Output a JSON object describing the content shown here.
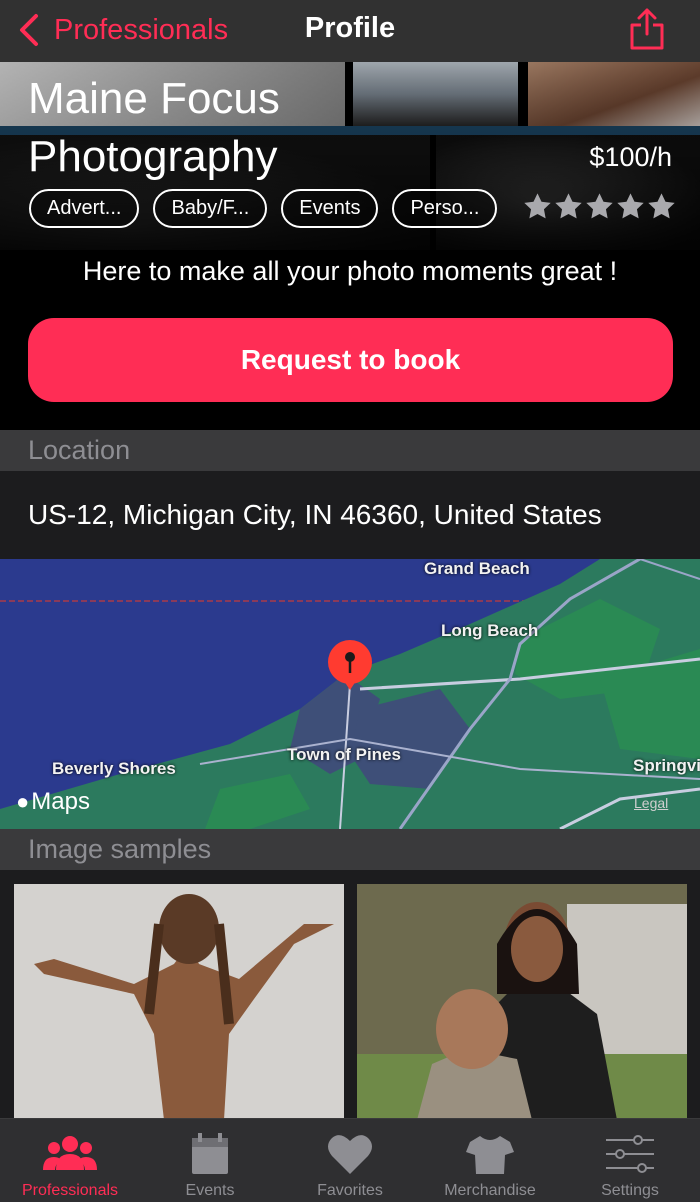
{
  "nav": {
    "back_label": "Professionals",
    "title": "Profile"
  },
  "profile": {
    "name_line1": "Maine Focus",
    "name_line2": "Photography",
    "rate": "$100/h",
    "categories": [
      "Advert...",
      "Baby/F...",
      "Events",
      "Perso..."
    ],
    "rating_filled": 0,
    "rating_max": 5,
    "tagline": "Here to make all your photo moments great !",
    "book_label": "Request to book"
  },
  "location": {
    "header": "Location",
    "address": "US-12, Michigan City, IN 46360, United States",
    "map": {
      "labels": [
        "Grand Beach",
        "Long Beach",
        "Beverly Shores",
        "Town of Pines",
        "Springvi"
      ],
      "provider": "Maps",
      "legal": "Legal"
    }
  },
  "samples": {
    "header": "Image samples"
  },
  "tabs": [
    {
      "label": "Professionals",
      "icon": "people-icon",
      "active": true
    },
    {
      "label": "Events",
      "icon": "calendar-icon",
      "active": false
    },
    {
      "label": "Favorites",
      "icon": "heart-icon",
      "active": false
    },
    {
      "label": "Merchandise",
      "icon": "shirt-icon",
      "active": false
    },
    {
      "label": "Settings",
      "icon": "sliders-icon",
      "active": false
    }
  ],
  "colors": {
    "accent": "#ff2d55",
    "background": "#000000",
    "section": "#3a3a3c",
    "tab_inactive": "#8e8e93"
  }
}
